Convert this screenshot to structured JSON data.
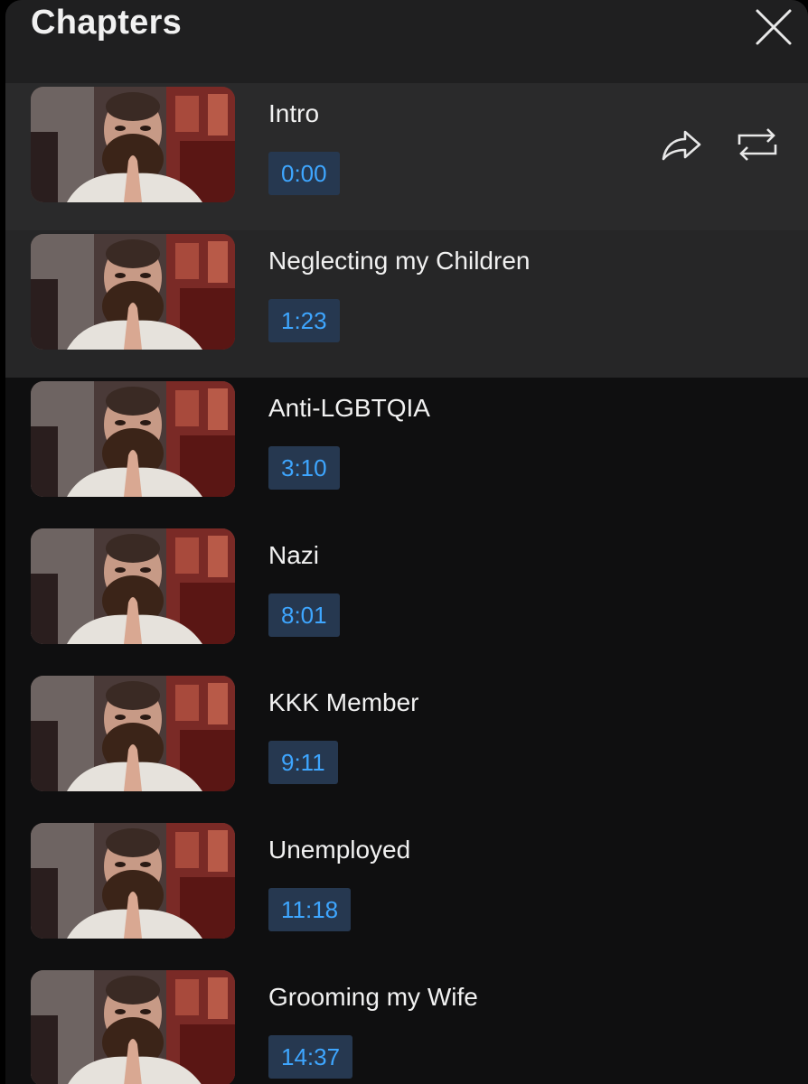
{
  "header": {
    "title": "Chapters"
  },
  "icons": {
    "close": "close-icon",
    "share": "share-icon",
    "repeat": "repeat-icon"
  },
  "colors": {
    "header_bg": "#1f1f20",
    "list_bg": "#0f0f10",
    "active_row_bg": "#2a2a2b",
    "timestamp_text": "#3ea6ff",
    "timestamp_bg": "#263850",
    "title_text": "#f1f1f1"
  },
  "chapters": [
    {
      "title": "Intro",
      "time": "0:00",
      "state": "active"
    },
    {
      "title": "Neglecting my Children",
      "time": "1:23",
      "state": "hover"
    },
    {
      "title": "Anti-LGBTQIA",
      "time": "3:10",
      "state": "normal"
    },
    {
      "title": "Nazi",
      "time": "8:01",
      "state": "normal"
    },
    {
      "title": "KKK Member",
      "time": "9:11",
      "state": "normal"
    },
    {
      "title": "Unemployed",
      "time": "11:18",
      "state": "normal"
    },
    {
      "title": "Grooming my Wife",
      "time": "14:37",
      "state": "normal"
    }
  ]
}
